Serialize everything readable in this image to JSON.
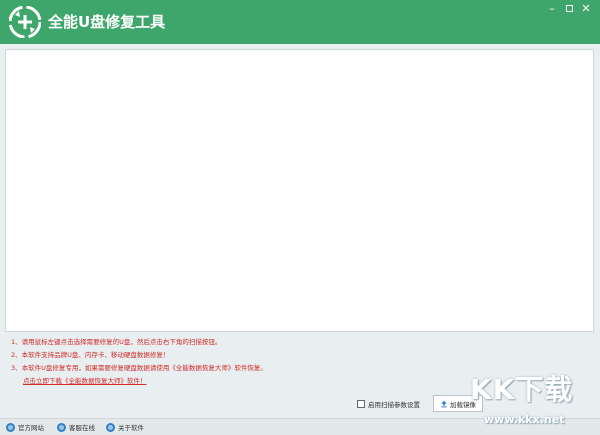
{
  "app": {
    "title": "全能U盘修复工具"
  },
  "window_controls": {
    "minimize": "–",
    "close": "✕"
  },
  "notes": {
    "line1": "1、请用鼠标左键点击选择需要修复的U盘，然后点击右下角的扫描按钮。",
    "line2": "2、本软件支持品牌U盘、内存卡、移动硬盘数据修复！",
    "line3": "3、本软件U盘修复专用，如果需要修复硬盘数据请使用《全能数据恢复大师》软件恢复。",
    "link": "点击立即下载《全能数据恢复大师》软件！"
  },
  "options": {
    "scan_setting_label": "启用扫描参数设置",
    "scan_setting_checked": false,
    "load_image_label": "加载镜像"
  },
  "footer": {
    "website": "官方网站",
    "support": "客服在线",
    "about": "关于软件"
  },
  "watermark": {
    "main": "KK下载",
    "url": "www.kkx.net"
  },
  "colors": {
    "titlebar": "#3ea66b",
    "note_text": "#d12b2b",
    "footer_icon": "#2f7fc8"
  }
}
